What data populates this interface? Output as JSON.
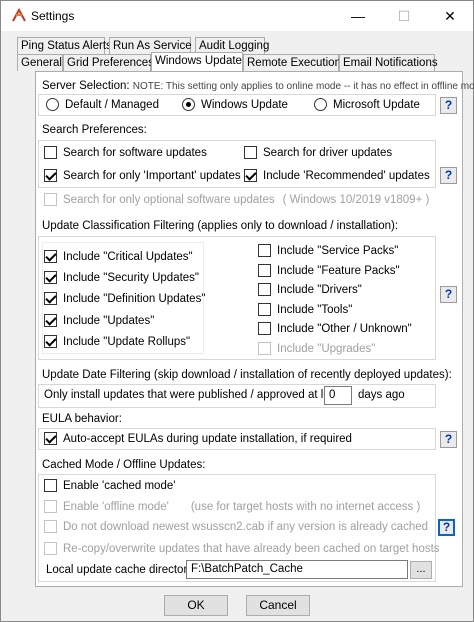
{
  "window": {
    "title": "Settings"
  },
  "tabs_back": [
    "Ping Status Alerts",
    "Run As Service",
    "Audit Logging"
  ],
  "tabs_front": [
    "General",
    "Grid Preferences",
    "Windows Update",
    "Remote Execution",
    "Email Notifications"
  ],
  "server": {
    "label": "Server Selection:",
    "note": "NOTE: This setting only applies to online mode -- it has no effect in offline mode",
    "options": [
      "Default / Managed",
      "Windows Update",
      "Microsoft Update"
    ],
    "selected": "Windows Update"
  },
  "search": {
    "label": "Search Preferences:",
    "software": "Search for software updates",
    "drivers": "Search for driver updates",
    "important": "Search for only 'Important' updates",
    "recommended": "Include 'Recommended' updates",
    "optional": "Search for only optional software updates",
    "optional_note": "( Windows 10/2019 v1809+ )"
  },
  "classification": {
    "label": "Update Classification Filtering (applies only to download / installation):",
    "left": [
      "Include \"Critical Updates\"",
      "Include \"Security Updates\"",
      "Include \"Definition Updates\"",
      "Include \"Updates\"",
      "Include \"Update Rollups\""
    ],
    "right": [
      "Include \"Service Packs\"",
      "Include \"Feature Packs\"",
      "Include \"Drivers\"",
      "Include \"Tools\"",
      "Include \"Other / Unknown\"",
      "Include \"Upgrades\""
    ]
  },
  "date": {
    "label": "Update Date Filtering (skip download / installation of recently deployed updates):",
    "prefix": "Only install updates that were published / approved at least",
    "value": "0",
    "suffix": "days ago"
  },
  "eula": {
    "label": "EULA behavior:",
    "text": "Auto-accept EULAs during update installation, if required"
  },
  "cache": {
    "label": "Cached Mode / Offline Updates:",
    "cached": "Enable 'cached mode'",
    "offline": "Enable 'offline mode'",
    "offline_note": "(use for target hosts with no internet access )",
    "nodl": "Do not download newest wsusscn2.cab if any version is already cached",
    "recopy": "Re-copy/overwrite updates that have already been cached on target hosts",
    "dir_label": "Local update cache directory:",
    "dir_value": "F:\\BatchPatch_Cache",
    "browse": "..."
  },
  "help": "?",
  "buttons": {
    "ok": "OK",
    "cancel": "Cancel"
  }
}
